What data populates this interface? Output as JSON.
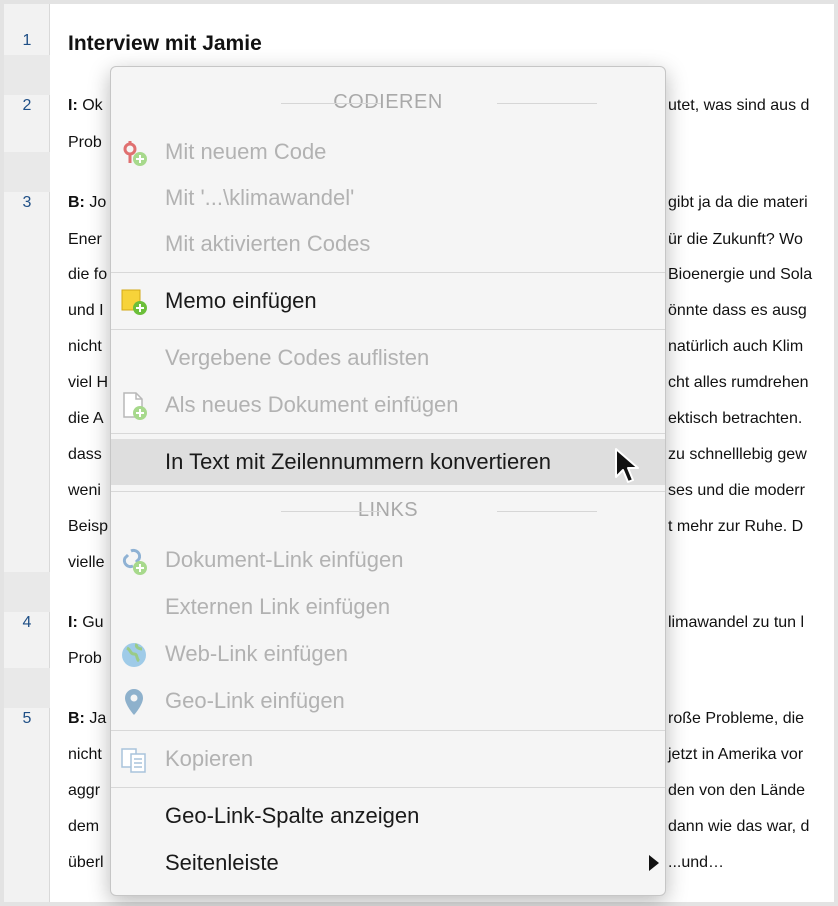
{
  "document": {
    "title": "Interview mit Jamie",
    "line_numbers": [
      "1",
      "2",
      "3",
      "4",
      "5"
    ],
    "left_fragments": {
      "p2": [
        {
          "speaker": "I:",
          "text": " Ok"
        },
        {
          "speaker": "",
          "text": "Prob"
        }
      ],
      "p3": [
        {
          "speaker": "B:",
          "text": " Jo"
        },
        {
          "speaker": "",
          "text": "Ener"
        },
        {
          "speaker": "",
          "text": "die fo"
        },
        {
          "speaker": "",
          "text": "und I"
        },
        {
          "speaker": "",
          "text": "nicht"
        },
        {
          "speaker": "",
          "text": "viel H"
        },
        {
          "speaker": "",
          "text": "die A"
        },
        {
          "speaker": "",
          "text": "dass"
        },
        {
          "speaker": "",
          "text": "weni"
        },
        {
          "speaker": "",
          "text": "Beisp"
        },
        {
          "speaker": "",
          "text": "vielle"
        }
      ],
      "p4": [
        {
          "speaker": "I:",
          "text": " Gu"
        },
        {
          "speaker": "",
          "text": "Prob"
        }
      ],
      "p5": [
        {
          "speaker": "B:",
          "text": " Ja"
        },
        {
          "speaker": "",
          "text": "nicht"
        },
        {
          "speaker": "",
          "text": "aggr"
        },
        {
          "speaker": "",
          "text": "dem"
        },
        {
          "speaker": "",
          "text": "überl"
        }
      ]
    },
    "right_fragments": {
      "p2": [
        "utet, was sind aus d"
      ],
      "p3": [
        "gibt ja da die materi",
        "ür die Zukunft? Wo",
        "Bioenergie und Sola",
        "önnte dass es ausg",
        "natürlich auch Klim",
        "cht alles rumdrehen",
        "ektisch betrachten.",
        "zu schnelllebig gew",
        "ses und die moderr",
        "t mehr zur Ruhe. D"
      ],
      "p4": [
        "limawandel zu tun l"
      ],
      "p5": [
        "roße Probleme, die",
        "jetzt in Amerika vor",
        "den von den Lände",
        "dann wie das war, d",
        "...und…"
      ]
    }
  },
  "menu": {
    "sections": {
      "codieren": "CODIEREN",
      "links": "LINKS"
    },
    "items": {
      "new_code": {
        "label": "Mit neuem Code",
        "enabled": false,
        "icon": "code-add-icon"
      },
      "klimawandel": {
        "label": "Mit '...\\klimawandel'",
        "enabled": false
      },
      "activated_codes": {
        "label": "Mit aktivierten Codes",
        "enabled": false
      },
      "insert_memo": {
        "label": "Memo einfügen",
        "enabled": true,
        "icon": "memo-add-icon"
      },
      "list_codes": {
        "label": "Vergebene Codes auflisten",
        "enabled": false
      },
      "insert_new_doc": {
        "label": "Als neues Dokument einfügen",
        "enabled": false,
        "icon": "document-add-icon"
      },
      "convert_text": {
        "label": "In Text mit Zeilennummern konvertieren",
        "enabled": true,
        "highlighted": true
      },
      "doc_link": {
        "label": "Dokument-Link einfügen",
        "enabled": false,
        "icon": "document-link-icon"
      },
      "external_link": {
        "label": "Externen Link einfügen",
        "enabled": false
      },
      "web_link": {
        "label": "Web-Link einfügen",
        "enabled": false,
        "icon": "globe-icon"
      },
      "geo_link": {
        "label": "Geo-Link einfügen",
        "enabled": false,
        "icon": "location-pin-icon"
      },
      "copy": {
        "label": "Kopieren",
        "enabled": false,
        "icon": "copy-icon"
      },
      "geo_column": {
        "label": "Geo-Link-Spalte anzeigen",
        "enabled": true
      },
      "sidebar": {
        "label": "Seitenleiste",
        "enabled": true,
        "submenu": true
      }
    }
  },
  "colors": {
    "line_number": "#1f4f86",
    "disabled_text": "#b2b2b2",
    "highlight": "#dedede",
    "memo_yellow": "#f7d33a",
    "add_green": "#6cbf3a"
  }
}
